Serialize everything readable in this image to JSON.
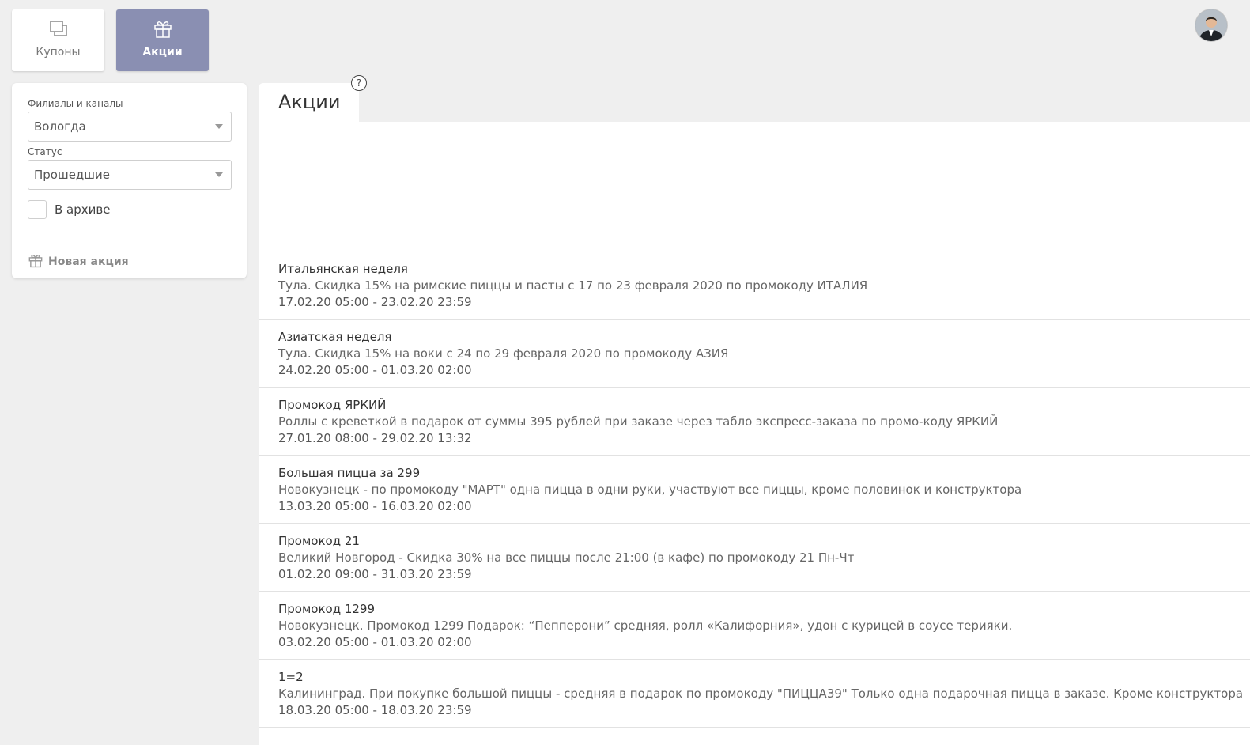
{
  "nav": {
    "tabs": [
      {
        "label": "Купоны",
        "icon": "coupons-icon",
        "active": false
      },
      {
        "label": "Акции",
        "icon": "gift-icon",
        "active": true
      }
    ]
  },
  "filters": {
    "branches_label": "Филиалы и каналы",
    "branches_value": "Вологда",
    "status_label": "Статус",
    "status_value": "Прошедшие",
    "archive_label": "В архиве",
    "archive_checked": false,
    "new_promo_label": "Новая акция"
  },
  "main": {
    "title": "Акции",
    "help": "?"
  },
  "promos": [
    {
      "name": "Итальянская неделя",
      "desc": "Тула. Скидка 15% на римские пиццы и пасты с 17 по 23 февраля 2020 по промокоду ИТАЛИЯ",
      "dates": "17.02.20 05:00  -  23.02.20 23:59"
    },
    {
      "name": "Азиатская неделя",
      "desc": "Тула. Скидка 15% на воки с 24 по 29 февраля 2020 по промокоду АЗИЯ",
      "dates": "24.02.20 05:00  -  01.03.20 02:00"
    },
    {
      "name": "Промокод ЯРКИЙ",
      "desc": "Роллы с креветкой в подарок от суммы 395 рублей при заказе через табло экспресс-заказа по промо-коду ЯРКИЙ",
      "dates": "27.01.20 08:00  -  29.02.20 13:32"
    },
    {
      "name": "Большая пицца за 299",
      "desc": "Новокузнецк - по промокоду \"МАРТ\" одна пицца в одни руки, участвуют все пиццы, кроме половинок и конструктора",
      "dates": "13.03.20 05:00  -  16.03.20 02:00"
    },
    {
      "name": "Промокод 21",
      "desc": "Великий Новгород - Скидка 30% на все пиццы после 21:00 (в кафе) по промокоду 21 Пн-Чт",
      "dates": "01.02.20 09:00  -  31.03.20 23:59"
    },
    {
      "name": "Промокод 1299",
      "desc": "Новокузнецк. Промокод 1299 Подарок: “Пепперони” средняя, ролл «Калифорния», удон с курицей в соусе терияки.",
      "dates": "03.02.20 05:00  -  01.03.20 02:00"
    },
    {
      "name": "1=2",
      "desc": "Калининград. При покупке большой пиццы - средняя в подарок по промокоду \"ПИЦЦА39\" Только одна подарочная пицца в заказе. Кроме конструктора",
      "dates": "18.03.20 05:00  -  18.03.20 23:59"
    }
  ]
}
